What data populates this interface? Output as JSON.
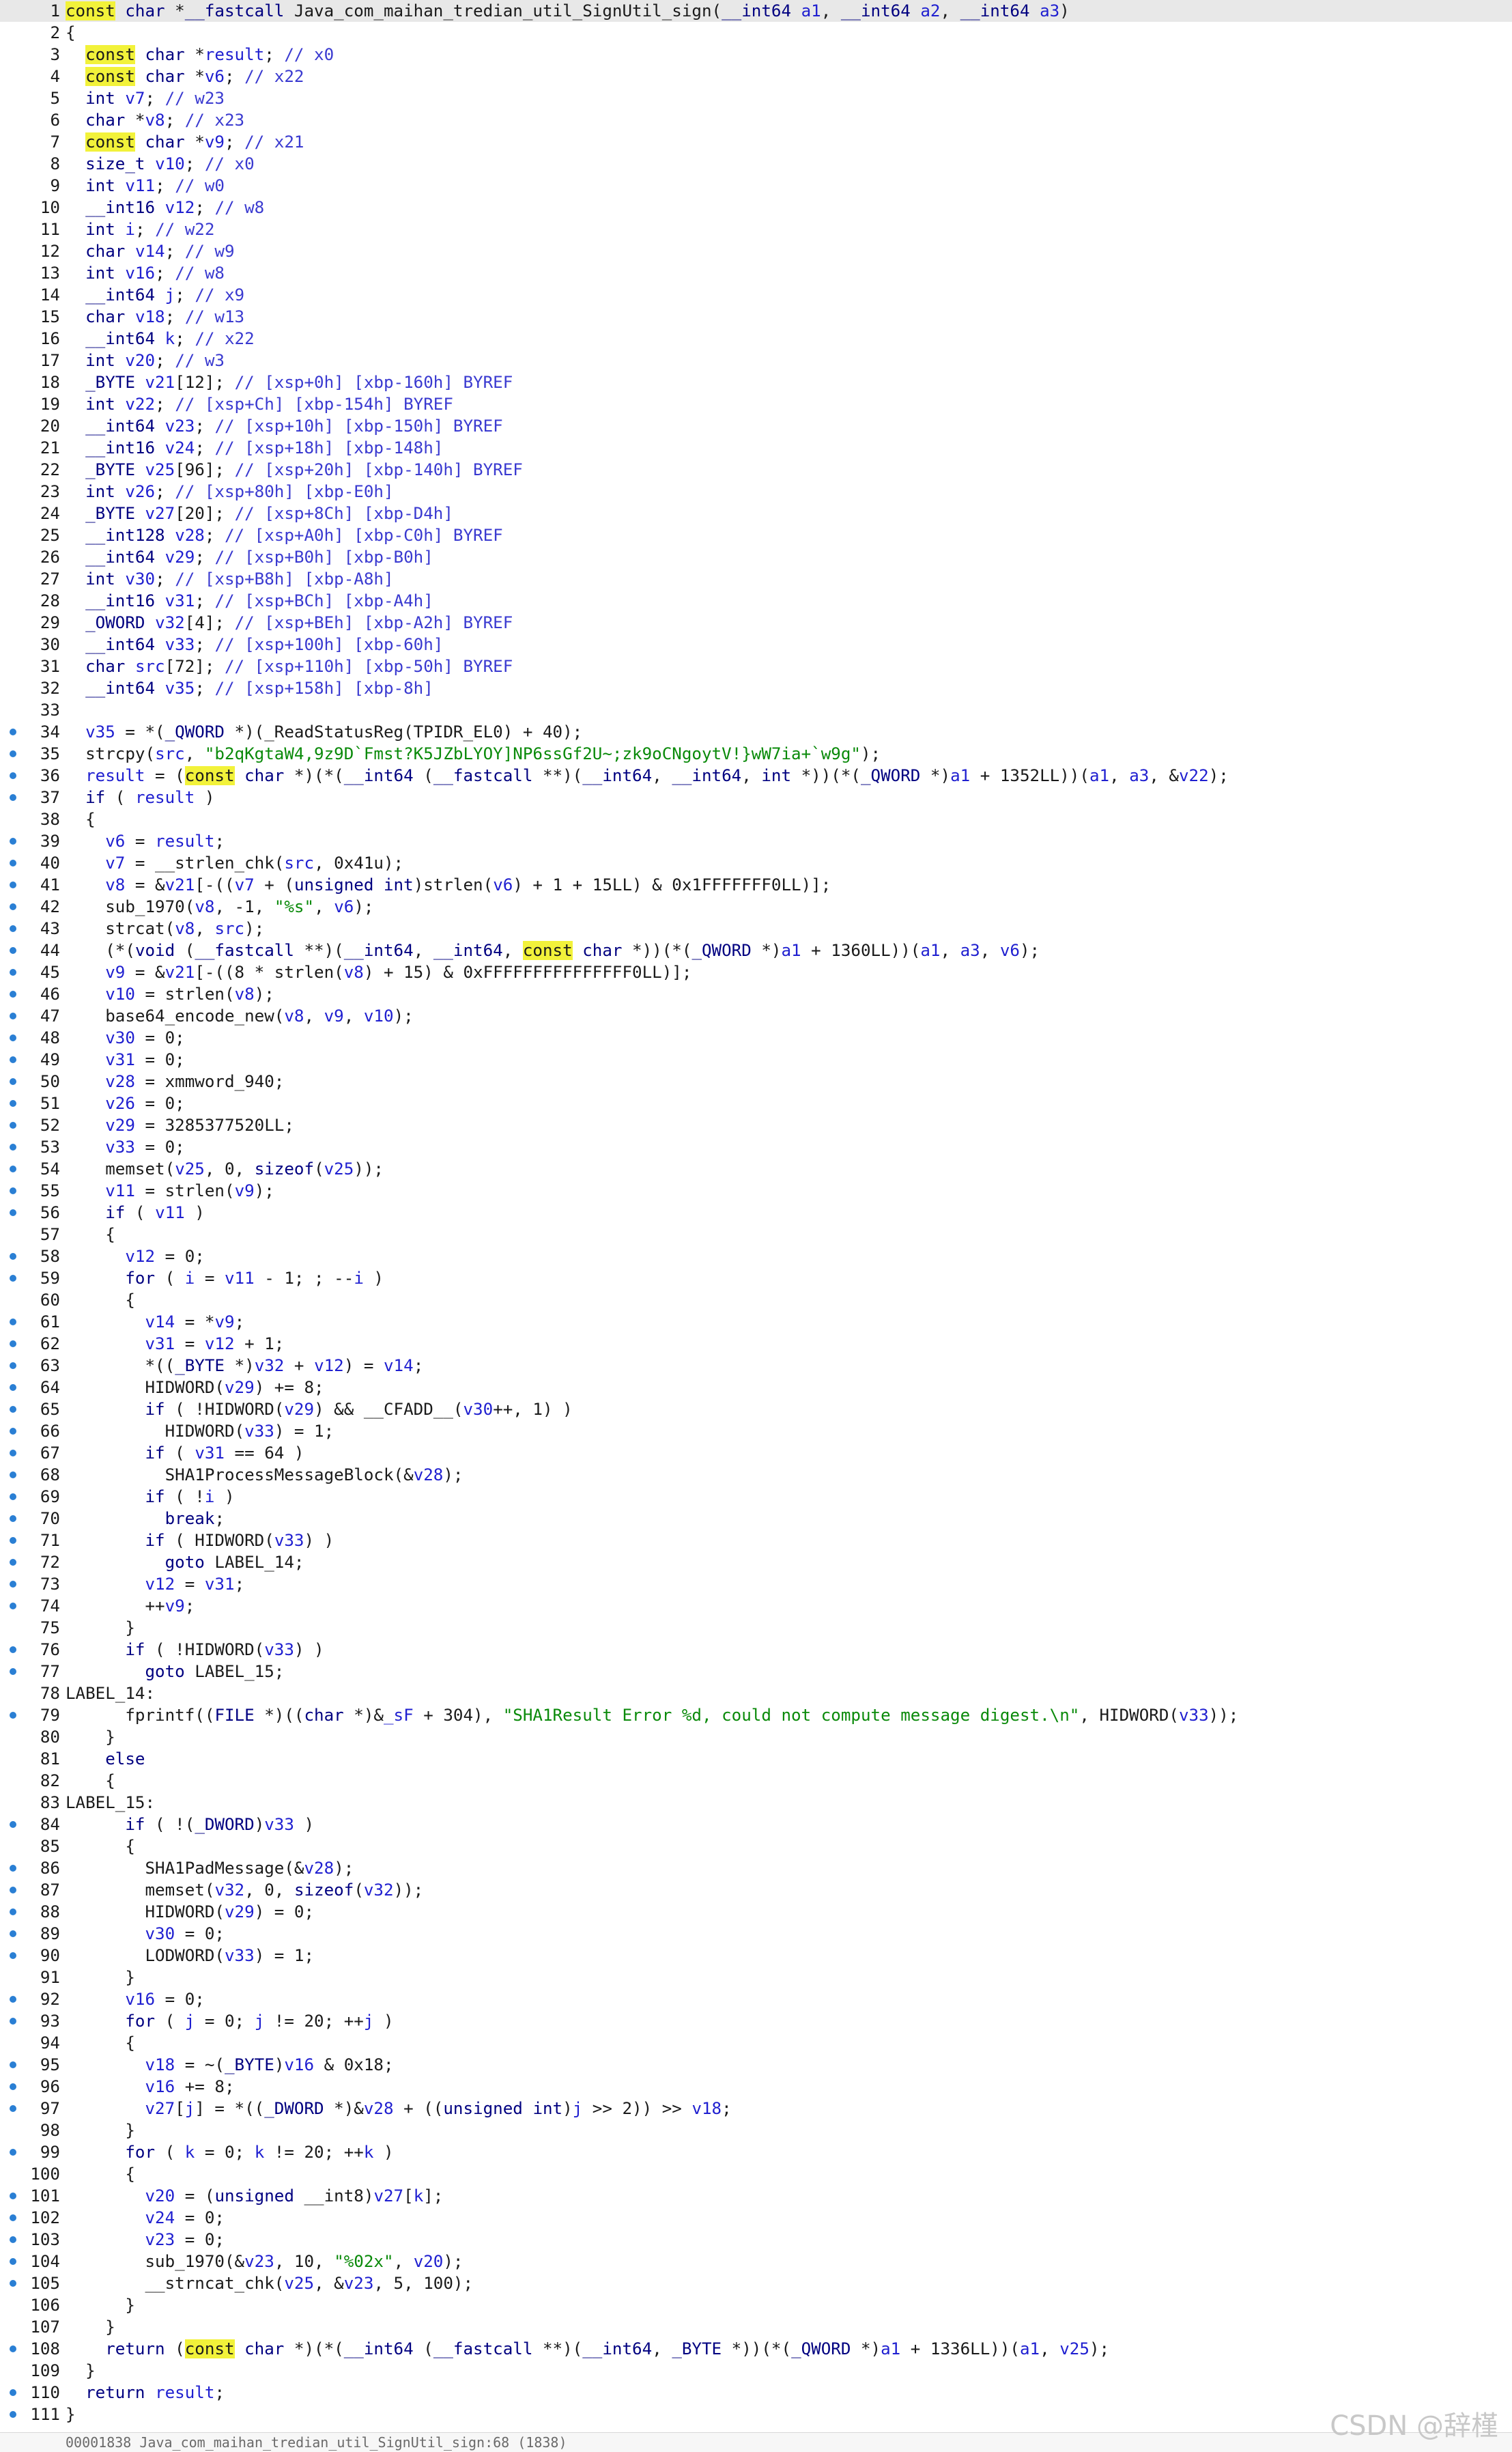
{
  "editor": {
    "lines": [
      {
        "n": "1",
        "t": "const char *__fastcall Java_com_maihan_tredian_util_SignUtil_sign(__int64 a1, __int64 a2, __int64 a3)",
        "dot": false
      },
      {
        "n": "2",
        "t": "{",
        "dot": false
      },
      {
        "n": "3",
        "t": "  const char *result; // x0",
        "dot": false
      },
      {
        "n": "4",
        "t": "  const char *v6; // x22",
        "dot": false
      },
      {
        "n": "5",
        "t": "  int v7; // w23",
        "dot": false
      },
      {
        "n": "6",
        "t": "  char *v8; // x23",
        "dot": false
      },
      {
        "n": "7",
        "t": "  const char *v9; // x21",
        "dot": false
      },
      {
        "n": "8",
        "t": "  size_t v10; // x0",
        "dot": false
      },
      {
        "n": "9",
        "t": "  int v11; // w0",
        "dot": false
      },
      {
        "n": "10",
        "t": "  __int16 v12; // w8",
        "dot": false
      },
      {
        "n": "11",
        "t": "  int i; // w22",
        "dot": false
      },
      {
        "n": "12",
        "t": "  char v14; // w9",
        "dot": false
      },
      {
        "n": "13",
        "t": "  int v16; // w8",
        "dot": false
      },
      {
        "n": "14",
        "t": "  __int64 j; // x9",
        "dot": false
      },
      {
        "n": "15",
        "t": "  char v18; // w13",
        "dot": false
      },
      {
        "n": "16",
        "t": "  __int64 k; // x22",
        "dot": false
      },
      {
        "n": "17",
        "t": "  int v20; // w3",
        "dot": false
      },
      {
        "n": "18",
        "t": "  _BYTE v21[12]; // [xsp+0h] [xbp-160h] BYREF",
        "dot": false
      },
      {
        "n": "19",
        "t": "  int v22; // [xsp+Ch] [xbp-154h] BYREF",
        "dot": false
      },
      {
        "n": "20",
        "t": "  __int64 v23; // [xsp+10h] [xbp-150h] BYREF",
        "dot": false
      },
      {
        "n": "21",
        "t": "  __int16 v24; // [xsp+18h] [xbp-148h]",
        "dot": false
      },
      {
        "n": "22",
        "t": "  _BYTE v25[96]; // [xsp+20h] [xbp-140h] BYREF",
        "dot": false
      },
      {
        "n": "23",
        "t": "  int v26; // [xsp+80h] [xbp-E0h]",
        "dot": false
      },
      {
        "n": "24",
        "t": "  _BYTE v27[20]; // [xsp+8Ch] [xbp-D4h]",
        "dot": false
      },
      {
        "n": "25",
        "t": "  __int128 v28; // [xsp+A0h] [xbp-C0h] BYREF",
        "dot": false
      },
      {
        "n": "26",
        "t": "  __int64 v29; // [xsp+B0h] [xbp-B0h]",
        "dot": false
      },
      {
        "n": "27",
        "t": "  int v30; // [xsp+B8h] [xbp-A8h]",
        "dot": false
      },
      {
        "n": "28",
        "t": "  __int16 v31; // [xsp+BCh] [xbp-A4h]",
        "dot": false
      },
      {
        "n": "29",
        "t": "  _OWORD v32[4]; // [xsp+BEh] [xbp-A2h] BYREF",
        "dot": false
      },
      {
        "n": "30",
        "t": "  __int64 v33; // [xsp+100h] [xbp-60h]",
        "dot": false
      },
      {
        "n": "31",
        "t": "  char src[72]; // [xsp+110h] [xbp-50h] BYREF",
        "dot": false
      },
      {
        "n": "32",
        "t": "  __int64 v35; // [xsp+158h] [xbp-8h]",
        "dot": false
      },
      {
        "n": "33",
        "t": "",
        "dot": false
      },
      {
        "n": "34",
        "t": "  v35 = *(_QWORD *)(_ReadStatusReg(TPIDR_EL0) + 40);",
        "dot": true
      },
      {
        "n": "35",
        "t": "  strcpy(src, \"b2qKgtaW4,9z9D`Fmst?K5JZbLYOY]NP6ssGf2U~;zk9oCNgoytV!}wW7ia+`w9g\");",
        "dot": true
      },
      {
        "n": "36",
        "t": "  result = (const char *)(*(__int64 (__fastcall **)(__int64, __int64, int *))(*(_QWORD *)a1 + 1352LL))(a1, a3, &v22);",
        "dot": true
      },
      {
        "n": "37",
        "t": "  if ( result )",
        "dot": true
      },
      {
        "n": "38",
        "t": "  {",
        "dot": false
      },
      {
        "n": "39",
        "t": "    v6 = result;",
        "dot": true
      },
      {
        "n": "40",
        "t": "    v7 = __strlen_chk(src, 0x41u);",
        "dot": true
      },
      {
        "n": "41",
        "t": "    v8 = &v21[-((v7 + (unsigned int)strlen(v6) + 1 + 15LL) & 0x1FFFFFFF0LL)];",
        "dot": true
      },
      {
        "n": "42",
        "t": "    sub_1970(v8, -1, \"%s\", v6);",
        "dot": true
      },
      {
        "n": "43",
        "t": "    strcat(v8, src);",
        "dot": true
      },
      {
        "n": "44",
        "t": "    (*(void (__fastcall **)(__int64, __int64, const char *))(*(_QWORD *)a1 + 1360LL))(a1, a3, v6);",
        "dot": true
      },
      {
        "n": "45",
        "t": "    v9 = &v21[-((8 * strlen(v8) + 15) & 0xFFFFFFFFFFFFFFF0LL)];",
        "dot": true
      },
      {
        "n": "46",
        "t": "    v10 = strlen(v8);",
        "dot": true
      },
      {
        "n": "47",
        "t": "    base64_encode_new(v8, v9, v10);",
        "dot": true
      },
      {
        "n": "48",
        "t": "    v30 = 0;",
        "dot": true
      },
      {
        "n": "49",
        "t": "    v31 = 0;",
        "dot": true
      },
      {
        "n": "50",
        "t": "    v28 = xmmword_940;",
        "dot": true
      },
      {
        "n": "51",
        "t": "    v26 = 0;",
        "dot": true
      },
      {
        "n": "52",
        "t": "    v29 = 3285377520LL;",
        "dot": true
      },
      {
        "n": "53",
        "t": "    v33 = 0;",
        "dot": true
      },
      {
        "n": "54",
        "t": "    memset(v25, 0, sizeof(v25));",
        "dot": true
      },
      {
        "n": "55",
        "t": "    v11 = strlen(v9);",
        "dot": true
      },
      {
        "n": "56",
        "t": "    if ( v11 )",
        "dot": true
      },
      {
        "n": "57",
        "t": "    {",
        "dot": false
      },
      {
        "n": "58",
        "t": "      v12 = 0;",
        "dot": true
      },
      {
        "n": "59",
        "t": "      for ( i = v11 - 1; ; --i )",
        "dot": true
      },
      {
        "n": "60",
        "t": "      {",
        "dot": false
      },
      {
        "n": "61",
        "t": "        v14 = *v9;",
        "dot": true
      },
      {
        "n": "62",
        "t": "        v31 = v12 + 1;",
        "dot": true
      },
      {
        "n": "63",
        "t": "        *((_BYTE *)v32 + v12) = v14;",
        "dot": true
      },
      {
        "n": "64",
        "t": "        HIDWORD(v29) += 8;",
        "dot": true
      },
      {
        "n": "65",
        "t": "        if ( !HIDWORD(v29) && __CFADD__(v30++, 1) )",
        "dot": true
      },
      {
        "n": "66",
        "t": "          HIDWORD(v33) = 1;",
        "dot": true
      },
      {
        "n": "67",
        "t": "        if ( v31 == 64 )",
        "dot": true
      },
      {
        "n": "68",
        "t": "          SHA1ProcessMessageBlock(&v28);",
        "dot": true
      },
      {
        "n": "69",
        "t": "        if ( !i )",
        "dot": true
      },
      {
        "n": "70",
        "t": "          break;",
        "dot": true
      },
      {
        "n": "71",
        "t": "        if ( HIDWORD(v33) )",
        "dot": true
      },
      {
        "n": "72",
        "t": "          goto LABEL_14;",
        "dot": true
      },
      {
        "n": "73",
        "t": "        v12 = v31;",
        "dot": true
      },
      {
        "n": "74",
        "t": "        ++v9;",
        "dot": true
      },
      {
        "n": "75",
        "t": "      }",
        "dot": false
      },
      {
        "n": "76",
        "t": "      if ( !HIDWORD(v33) )",
        "dot": true
      },
      {
        "n": "77",
        "t": "        goto LABEL_15;",
        "dot": true
      },
      {
        "n": "78",
        "t": "LABEL_14:",
        "dot": false
      },
      {
        "n": "79",
        "t": "      fprintf((FILE *)((char *)&_sF + 304), \"SHA1Result Error %d, could not compute message digest.\\n\", HIDWORD(v33));",
        "dot": true
      },
      {
        "n": "80",
        "t": "    }",
        "dot": false
      },
      {
        "n": "81",
        "t": "    else",
        "dot": false
      },
      {
        "n": "82",
        "t": "    {",
        "dot": false
      },
      {
        "n": "83",
        "t": "LABEL_15:",
        "dot": false
      },
      {
        "n": "84",
        "t": "      if ( !(_DWORD)v33 )",
        "dot": true
      },
      {
        "n": "85",
        "t": "      {",
        "dot": false
      },
      {
        "n": "86",
        "t": "        SHA1PadMessage(&v28);",
        "dot": true
      },
      {
        "n": "87",
        "t": "        memset(v32, 0, sizeof(v32));",
        "dot": true
      },
      {
        "n": "88",
        "t": "        HIDWORD(v29) = 0;",
        "dot": true
      },
      {
        "n": "89",
        "t": "        v30 = 0;",
        "dot": true
      },
      {
        "n": "90",
        "t": "        LODWORD(v33) = 1;",
        "dot": true
      },
      {
        "n": "91",
        "t": "      }",
        "dot": false
      },
      {
        "n": "92",
        "t": "      v16 = 0;",
        "dot": true
      },
      {
        "n": "93",
        "t": "      for ( j = 0; j != 20; ++j )",
        "dot": true
      },
      {
        "n": "94",
        "t": "      {",
        "dot": false
      },
      {
        "n": "95",
        "t": "        v18 = ~(_BYTE)v16 & 0x18;",
        "dot": true
      },
      {
        "n": "96",
        "t": "        v16 += 8;",
        "dot": true
      },
      {
        "n": "97",
        "t": "        v27[j] = *((_DWORD *)&v28 + ((unsigned int)j >> 2)) >> v18;",
        "dot": true
      },
      {
        "n": "98",
        "t": "      }",
        "dot": false
      },
      {
        "n": "99",
        "t": "      for ( k = 0; k != 20; ++k )",
        "dot": true
      },
      {
        "n": "100",
        "t": "      {",
        "dot": false
      },
      {
        "n": "101",
        "t": "        v20 = (unsigned __int8)v27[k];",
        "dot": true
      },
      {
        "n": "102",
        "t": "        v24 = 0;",
        "dot": true
      },
      {
        "n": "103",
        "t": "        v23 = 0;",
        "dot": true
      },
      {
        "n": "104",
        "t": "        sub_1970(&v23, 10, \"%02x\", v20);",
        "dot": true
      },
      {
        "n": "105",
        "t": "        __strncat_chk(v25, &v23, 5, 100);",
        "dot": true
      },
      {
        "n": "106",
        "t": "      }",
        "dot": false
      },
      {
        "n": "107",
        "t": "    }",
        "dot": false
      },
      {
        "n": "108",
        "t": "    return (const char *)(*(__int64 (__fastcall **)(__int64, _BYTE *))(*(_QWORD *)a1 + 1336LL))(a1, v25);",
        "dot": true
      },
      {
        "n": "109",
        "t": "  }",
        "dot": false
      },
      {
        "n": "110",
        "t": "  return result;",
        "dot": true
      },
      {
        "n": "111",
        "t": "}",
        "dot": true
      }
    ]
  },
  "status_bar": {
    "text": "00001838 Java_com_maihan_tredian_util_SignUtil_sign:68 (1838)"
  },
  "watermark": {
    "text": "CSDN @辞槿"
  },
  "colors": {
    "keyword": "#000080",
    "variable": "#1f1fd0",
    "string": "#0a8a0a",
    "highlight": "#f2f23a",
    "breakpoint_dot": "#2a7fd4"
  }
}
